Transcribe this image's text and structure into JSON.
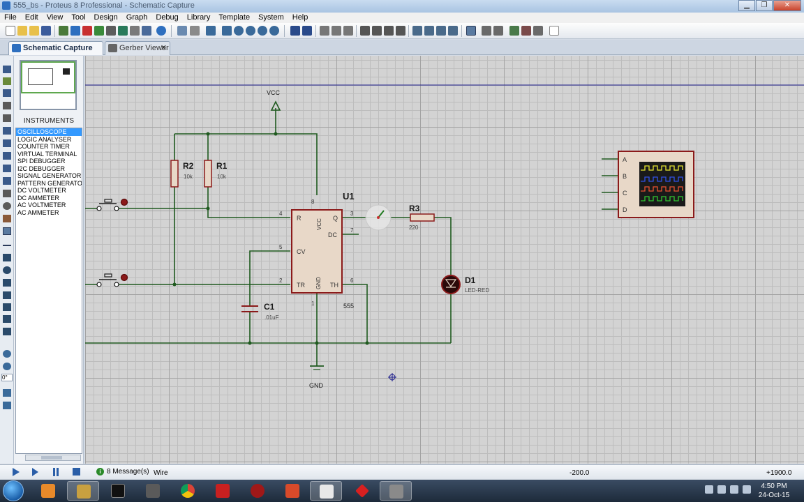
{
  "window": {
    "title": "555_bs - Proteus 8 Professional - Schematic Capture"
  },
  "menu": [
    "File",
    "Edit",
    "View",
    "Tool",
    "Design",
    "Graph",
    "Debug",
    "Library",
    "Template",
    "System",
    "Help"
  ],
  "tabs": [
    {
      "label": "Schematic Capture",
      "close": ""
    },
    {
      "label": "Gerber Viewer",
      "close": "✕"
    }
  ],
  "object_panel": {
    "header": "INSTRUMENTS",
    "items": [
      "OSCILLOSCOPE",
      "LOGIC ANALYSER",
      "COUNTER TIMER",
      "VIRTUAL TERMINAL",
      "SPI DEBUGGER",
      "I2C DEBUGGER",
      "SIGNAL GENERATOR",
      "PATTERN GENERATO",
      "DC VOLTMETER",
      "DC AMMETER",
      "AC VOLTMETER",
      "AC AMMETER"
    ],
    "selected_index": 0
  },
  "left_tools": {
    "rotation": "0°"
  },
  "schematic": {
    "vcc": "VCC",
    "gnd": "GND",
    "u1": {
      "ref": "U1",
      "value": "555",
      "pin_R": "R",
      "pin_vcc": "VCC",
      "pin_Q": "Q",
      "pin_dc": "DC",
      "pin_cv": "CV",
      "pin_tr": "TR",
      "pin_gnd": "GND",
      "pin_th": "TH",
      "pn4": "4",
      "pn8": "8",
      "pn3": "3",
      "pn7": "7",
      "pn5": "5",
      "pn2": "2",
      "pn6": "6",
      "pn1": "1"
    },
    "r1": {
      "ref": "R1",
      "value": "10k"
    },
    "r2": {
      "ref": "R2",
      "value": "10k"
    },
    "r3": {
      "ref": "R3",
      "value": "220"
    },
    "c1": {
      "ref": "C1",
      "value": ".01uF"
    },
    "d1": {
      "ref": "D1",
      "value": "LED-RED"
    },
    "scope": {
      "ch_a": "A",
      "ch_b": "B",
      "ch_c": "C",
      "ch_d": "D"
    }
  },
  "status": {
    "messages": "8 Message(s)",
    "mode": "Wire",
    "coord_x": "-200.0",
    "coord_y": "+1900.0",
    "info_icon": "i"
  },
  "taskbar": {
    "time": "4:50 PM",
    "date": "24-Oct-15"
  },
  "colors": {
    "wire": "#1f5a1f",
    "component": "#8b1a1a",
    "component_fill": "#e8d8c8",
    "canvas": "#d3d3d3",
    "selected": "#3399ff"
  }
}
